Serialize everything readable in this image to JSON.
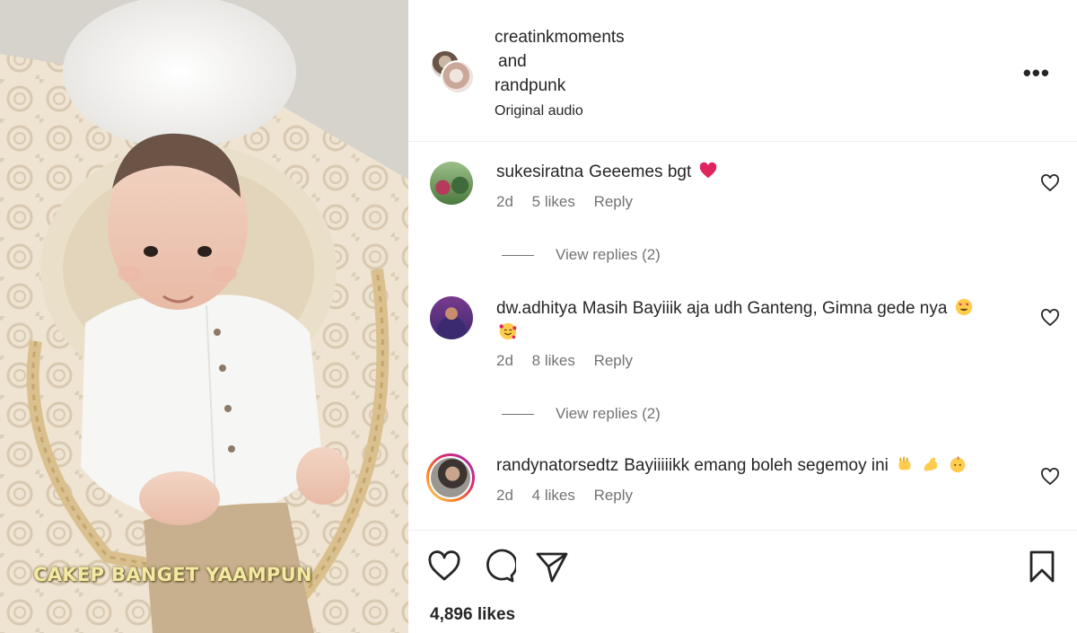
{
  "media": {
    "caption": "CAKEP BANGET YAAMPUN"
  },
  "header": {
    "user1": "creatinkmoments",
    "conjunction": "and",
    "user2": "randpunk",
    "audio": "Original audio",
    "more_label": "•••"
  },
  "comments": [
    {
      "username": "sukesiratna",
      "text": "Geeemes bgt",
      "emojis": [
        "red-heart"
      ],
      "age": "2d",
      "likes": "5 likes",
      "reply": "Reply",
      "view_replies": "View replies (2)"
    },
    {
      "username": "dw.adhitya",
      "text": "Masih Bayiiik aja udh Ganteng, Gimna gede nya",
      "emojis": [
        "heart-eyes",
        "smiling-face-with-hearts"
      ],
      "age": "2d",
      "likes": "8 likes",
      "reply": "Reply",
      "view_replies": "View replies (2)"
    },
    {
      "username": "randynatorsedtz",
      "text": "Bayiiiiikk emang boleh segemoy ini",
      "emojis": [
        "fist",
        "flexed-biceps",
        "baby"
      ],
      "age": "2d",
      "likes": "4 likes",
      "reply": "Reply"
    }
  ],
  "post": {
    "likes": "4,896 likes"
  },
  "colors": {
    "text": "#262626",
    "secondary": "#737373",
    "heart_red": "#ed4956",
    "caption_yellow": "#f3e9a2"
  }
}
